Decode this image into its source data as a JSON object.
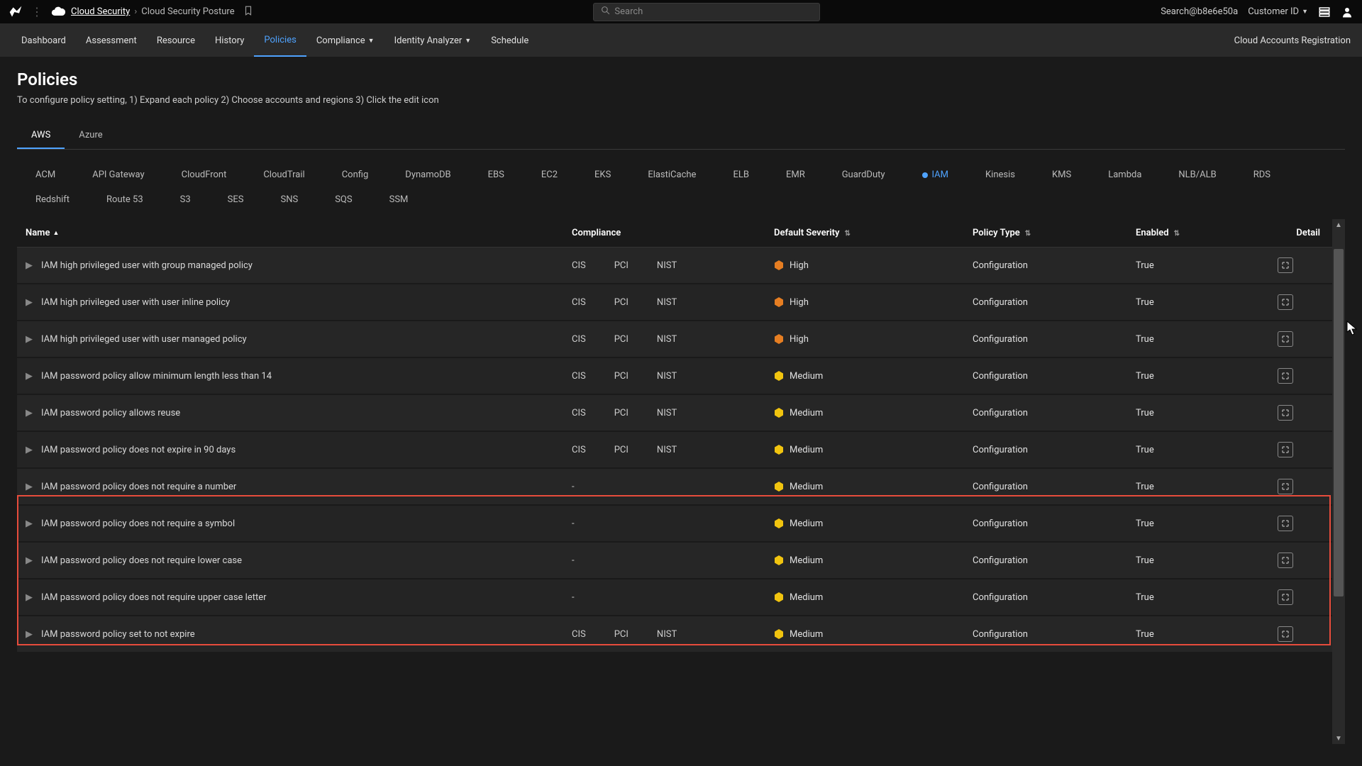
{
  "topbar": {
    "breadcrumb_root": "Cloud Security",
    "breadcrumb_current": "Cloud Security Posture",
    "search_placeholder": "Search",
    "user_email": "Search@b8e6e50a",
    "customer_label": "Customer ID"
  },
  "nav": {
    "items": [
      "Dashboard",
      "Assessment",
      "Resource",
      "History",
      "Policies",
      "Compliance",
      "Identity Analyzer",
      "Schedule"
    ],
    "active": "Policies",
    "right": "Cloud Accounts Registration"
  },
  "page": {
    "title": "Policies",
    "subtitle": "To configure policy setting, 1) Expand each policy 2) Choose accounts and regions 3) Click the edit icon"
  },
  "cloud_tabs": {
    "items": [
      "AWS",
      "Azure"
    ],
    "active": "AWS"
  },
  "services": {
    "items": [
      "ACM",
      "API Gateway",
      "CloudFront",
      "CloudTrail",
      "Config",
      "DynamoDB",
      "EBS",
      "EC2",
      "EKS",
      "ElastiCache",
      "ELB",
      "EMR",
      "GuardDuty",
      "IAM",
      "Kinesis",
      "KMS",
      "Lambda",
      "NLB/ALB",
      "RDS",
      "Redshift",
      "Route 53",
      "S3",
      "SES",
      "SNS",
      "SQS",
      "SSM"
    ],
    "active": "IAM"
  },
  "table": {
    "headers": {
      "name": "Name",
      "compliance": "Compliance",
      "severity": "Default Severity",
      "type": "Policy Type",
      "enabled": "Enabled",
      "detail": "Detail"
    },
    "rows": [
      {
        "name": "IAM high privileged user with group managed policy",
        "compliance": [
          "CIS",
          "PCI",
          "NIST"
        ],
        "severity": "High",
        "type": "Configuration",
        "enabled": "True",
        "hl": false
      },
      {
        "name": "IAM high privileged user with user inline policy",
        "compliance": [
          "CIS",
          "PCI",
          "NIST"
        ],
        "severity": "High",
        "type": "Configuration",
        "enabled": "True",
        "hl": false
      },
      {
        "name": "IAM high privileged user with user managed policy",
        "compliance": [
          "CIS",
          "PCI",
          "NIST"
        ],
        "severity": "High",
        "type": "Configuration",
        "enabled": "True",
        "hl": false
      },
      {
        "name": "IAM password policy allow minimum length less than 14",
        "compliance": [
          "CIS",
          "PCI",
          "NIST"
        ],
        "severity": "Medium",
        "type": "Configuration",
        "enabled": "True",
        "hl": false
      },
      {
        "name": "IAM password policy allows reuse",
        "compliance": [
          "CIS",
          "PCI",
          "NIST"
        ],
        "severity": "Medium",
        "type": "Configuration",
        "enabled": "True",
        "hl": false
      },
      {
        "name": "IAM password policy does not expire in 90 days",
        "compliance": [
          "CIS",
          "PCI",
          "NIST"
        ],
        "severity": "Medium",
        "type": "Configuration",
        "enabled": "True",
        "hl": false
      },
      {
        "name": "IAM password policy does not require a number",
        "compliance": [
          "-"
        ],
        "severity": "Medium",
        "type": "Configuration",
        "enabled": "True",
        "hl": true
      },
      {
        "name": "IAM password policy does not require a symbol",
        "compliance": [
          "-"
        ],
        "severity": "Medium",
        "type": "Configuration",
        "enabled": "True",
        "hl": true
      },
      {
        "name": "IAM password policy does not require lower case",
        "compliance": [
          "-"
        ],
        "severity": "Medium",
        "type": "Configuration",
        "enabled": "True",
        "hl": true
      },
      {
        "name": "IAM password policy does not require upper case letter",
        "compliance": [
          "-"
        ],
        "severity": "Medium",
        "type": "Configuration",
        "enabled": "True",
        "hl": true
      },
      {
        "name": "IAM password policy set to not expire",
        "compliance": [
          "CIS",
          "PCI",
          "NIST"
        ],
        "severity": "Medium",
        "type": "Configuration",
        "enabled": "True",
        "hl": false
      }
    ]
  }
}
